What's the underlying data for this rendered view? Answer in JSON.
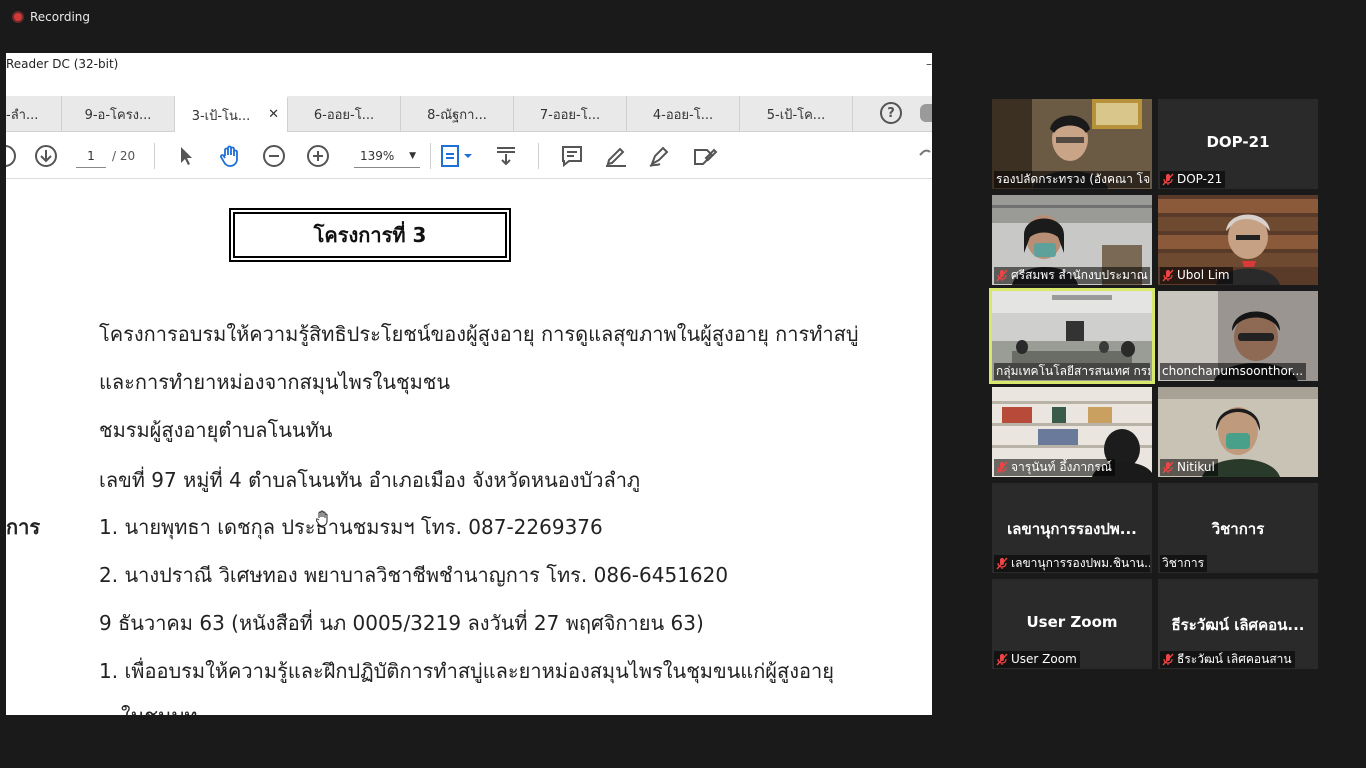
{
  "recording": {
    "label": "Recording"
  },
  "pdf": {
    "window_title": "Reader DC (32-bit)",
    "tabs": [
      {
        "label": "-ลำ..."
      },
      {
        "label": "9-อ-โครง..."
      },
      {
        "label": "3-เป้-โน...",
        "active": true
      },
      {
        "label": "6-ออย-โ..."
      },
      {
        "label": "8-ณัฐกา..."
      },
      {
        "label": "7-ออย-โ..."
      },
      {
        "label": "4-ออย-โ..."
      },
      {
        "label": "5-เป้-โค..."
      }
    ],
    "toolbar": {
      "page_current": "1",
      "page_total": "/ 20",
      "zoom": "139%"
    },
    "document": {
      "title": "โครงการที่   3",
      "lines": [
        "โครงการอบรมให้ความรู้สิทธิประโยชน์ของผู้สูงอายุ การดูแลสุขภาพในผู้สูงอายุ การทำสบู่",
        "และการทำยาหม่องจากสมุนไพรในชุมชน",
        "ชมรมผู้สูงอายุตำบลโนนทัน",
        "เลขที่ 97 หมู่ที่ 4 ตำบลโนนทัน อำเภอเมือง จังหวัดหนองบัวลำภู",
        "1. นายพุทธา เดชกุล ประธานชมรมฯ  โทร. 087-2269376",
        "2. นางปราณี วิเศษทอง พยาบาลวิชาชีพชำนาญการ  โทร. 086-6451620",
        "9 ธันวาคม 63 (หนังสือที่ นภ 0005/3219 ลงวันที่ 27 พฤศจิกายน 63)",
        "1. เพื่ออบรมให้ความรู้และฝึกปฏิบัติการทำสบู่และยาหม่องสมุนไพรในชุมขนแก่ผู้สูงอายุ",
        "ในชนบท"
      ],
      "side_label": "การ"
    }
  },
  "participants": [
    {
      "label": "รองปลัดกระทรวง (อังคณา โจ...",
      "muted": false,
      "video": "person-office"
    },
    {
      "label": "DOP-21",
      "big_name": "DOP-21",
      "muted": true,
      "video": "none"
    },
    {
      "label": "ศรีสมพร สำนักงบประมาณ",
      "muted": true,
      "video": "person-mask"
    },
    {
      "label": "Ubol Lim",
      "muted": true,
      "video": "person-books"
    },
    {
      "label": "กลุ่มเทคโนโลยีสารสนเทศ กรม...",
      "muted": false,
      "video": "meeting-room",
      "talking": true
    },
    {
      "label": "chonchanumsoonthor...",
      "muted": false,
      "video": "person-glasses"
    },
    {
      "label": "จารุนันท์ อึ้งภากรณ์",
      "muted": true,
      "video": "shelf"
    },
    {
      "label": "Nitikul",
      "muted": true,
      "video": "person-mask-green"
    },
    {
      "label": "เลขานุการรองปพม.ชินาน...",
      "big_name": "เลขานุการรองปพ...",
      "muted": true,
      "video": "none"
    },
    {
      "label": "วิชาการ",
      "big_name": "วิชาการ",
      "muted": false,
      "video": "none"
    },
    {
      "label": "User Zoom",
      "big_name": "User Zoom",
      "muted": true,
      "video": "none"
    },
    {
      "label": "ธีระวัฒน์ เลิศคอนสาน",
      "big_name": "ธีระวัฒน์ เลิศคอน...",
      "muted": true,
      "video": "none"
    }
  ]
}
